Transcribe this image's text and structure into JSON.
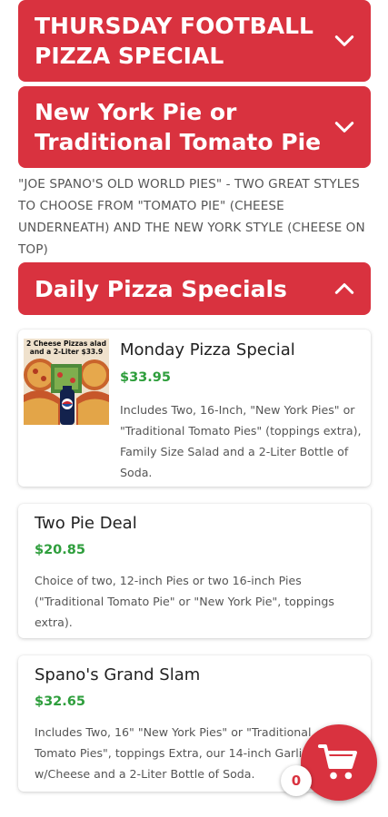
{
  "categories": [
    {
      "label": "THURSDAY FOOTBALL PIZZA SPECIAL",
      "state": "collapsed"
    },
    {
      "label": "New York Pie or Traditional Tomato Pie",
      "state": "collapsed"
    },
    {
      "label": "Daily Pizza Specials",
      "state": "expanded"
    }
  ],
  "category_description": "\"JOE SPANO'S OLD WORLD PIES\" - TWO GREAT STYLES TO CHOOSE FROM \"TOMATO PIE\" (CHEESE UNDERNEATH) AND THE NEW YORK STYLE (CHEESE ON TOP)",
  "items": [
    {
      "name": "Monday Pizza Special",
      "price": "$33.95",
      "description": "Includes Two, 16-Inch, \"New York Pies\" or \"Traditional Tomato Pies\" (toppings extra), Family Size Salad and a 2-Liter Bottle of Soda.",
      "image_caption": "2 Cheese Pizzas alad and a 2-Liter $33.9"
    },
    {
      "name": "Two Pie Deal",
      "price": "$20.85",
      "description": "Choice of two, 12-inch Pies or two 16-inch Pies (\"Traditional Tomato Pie\" or \"New York Pie\", toppings extra)."
    },
    {
      "name": "Spano's Grand Slam",
      "price": "$32.65",
      "description": "Includes Two, 16\" \"New York Pies\" or \"Traditional Tomato Pies\", toppings Extra, our 14-inch Garlic Bread w/Cheese and a 2-Liter Bottle of Soda."
    }
  ],
  "cart": {
    "count": "0",
    "icon": "cart-icon"
  },
  "colors": {
    "accent": "#d9323f",
    "price": "#2e9e3c"
  }
}
